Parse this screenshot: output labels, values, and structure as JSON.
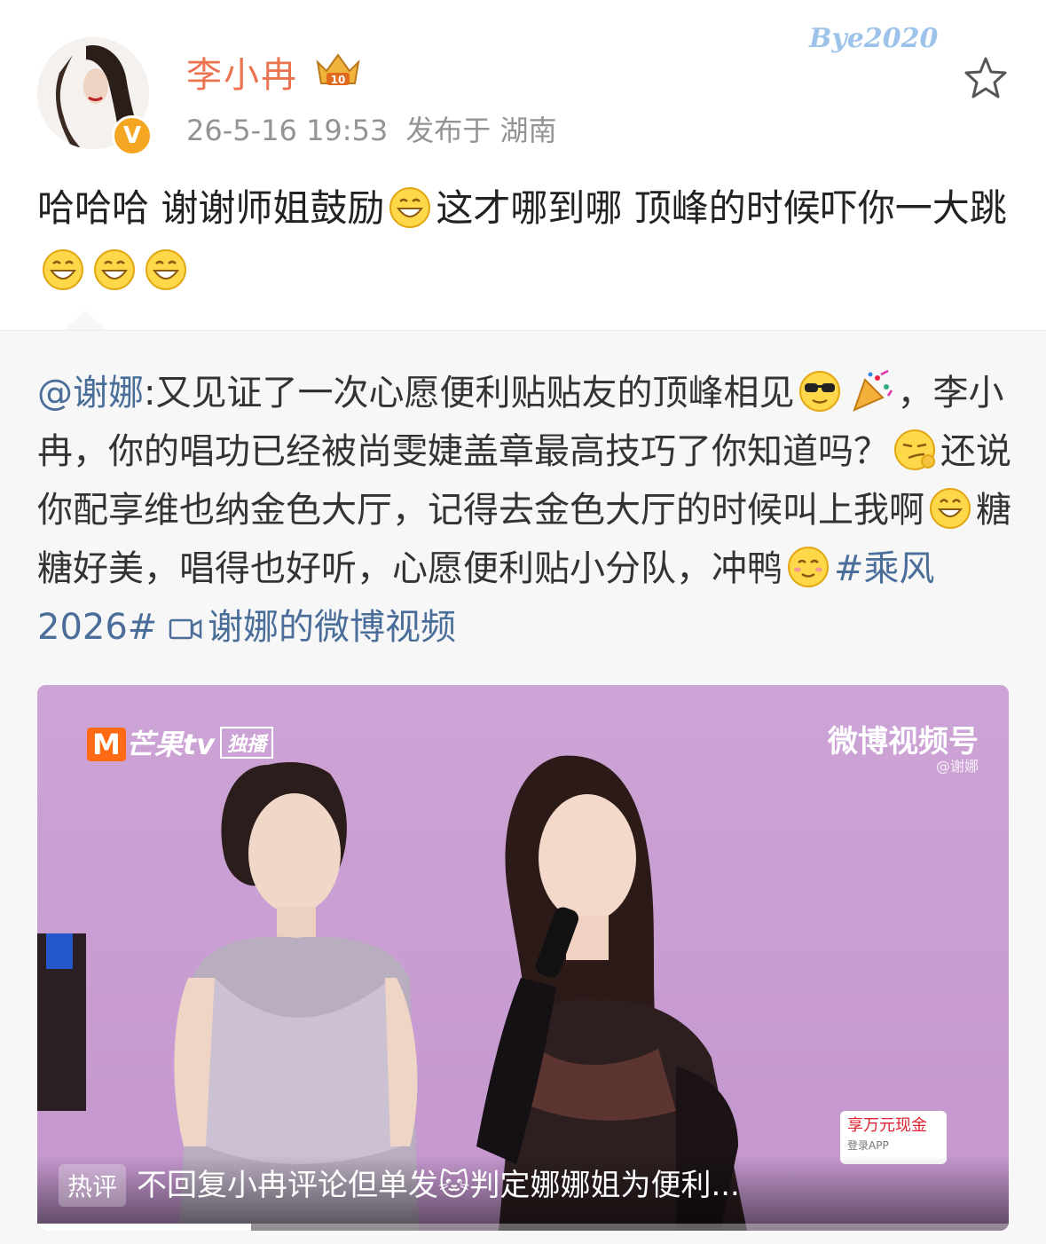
{
  "post": {
    "username": "李小冉",
    "time": "26-5-16 19:53",
    "location": "发布于 湖南",
    "watermark": "Bye2020",
    "body_segments": [
      "哈哈哈 谢谢师姐鼓励",
      "这才哪到哪 顶峰的时候吓你一大跳"
    ]
  },
  "repost": {
    "mention": "@谢娜",
    "seg1": ":又见证了一次心愿便利贴贴友的顶峰相见",
    "seg2": "，李小冉，你的唱功已经被尚雯婕盖章最高技巧了你知道吗？",
    "seg3": "还说你配享维也纳金色大厅，记得去金色大厅的时候叫上我啊",
    "seg4": "糖糖好美，唱得也好听，心愿便利贴小分队，冲鸭",
    "topic": "#乘风 2026#",
    "video_link": "谢娜的微博视频"
  },
  "video": {
    "channel_logo": "芒果tv",
    "channel_tag": "独播",
    "source": "微博视频号",
    "source_sub": "@谢娜",
    "hot_label": "热评",
    "hot_comment": "不回复小冉评论但单发🐱判定娜娜姐为便利...",
    "ad_title": "享万元现金",
    "ad_sub": "登录APP",
    "progress": 0.22
  },
  "colors": {
    "username": "#eb7350",
    "link": "#4a6e99",
    "verified": "#f5a623",
    "meta": "#939393",
    "video_bg": "#c9a2d3"
  },
  "icons": [
    "verified-badge-icon",
    "crown-badge-icon",
    "favorite-star-icon",
    "grin-emoji-icon",
    "sunglasses-emoji-icon",
    "party-popper-emoji-icon",
    "smirk-emoji-icon",
    "laugh-emoji-icon",
    "blush-emoji-icon",
    "video-link-icon"
  ]
}
